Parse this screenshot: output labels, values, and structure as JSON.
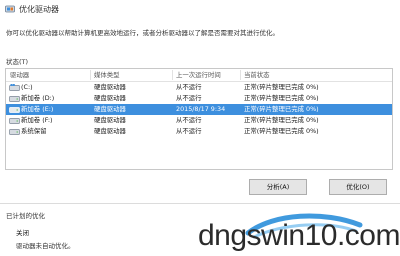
{
  "window": {
    "title": "优化驱动器"
  },
  "description": "你可以优化驱动器以帮助计算机更高效地运行，或者分析驱动器以了解是否需要对其进行优化。",
  "status_section": {
    "label": "状态(T)"
  },
  "drive_table": {
    "columns": [
      "驱动器",
      "媒体类型",
      "上一次运行时间",
      "当前状态"
    ],
    "rows": [
      {
        "drive": "(C:)",
        "media_type": "硬盘驱动器",
        "last_run": "从不运行",
        "status": "正常(碎片整理已完成 0%)",
        "selected": false,
        "icon": "hdd-windows-icon"
      },
      {
        "drive": "新加卷 (D:)",
        "media_type": "硬盘驱动器",
        "last_run": "从不运行",
        "status": "正常(碎片整理已完成 0%)",
        "selected": false,
        "icon": "hdd-icon"
      },
      {
        "drive": "新加卷 (E:)",
        "media_type": "硬盘驱动器",
        "last_run": "2015/8/17 9:34",
        "status": "正常(碎片整理已完成 0%)",
        "selected": true,
        "icon": "hdd-icon"
      },
      {
        "drive": "新加卷 (F:)",
        "media_type": "硬盘驱动器",
        "last_run": "从不运行",
        "status": "正常(碎片整理已完成 0%)",
        "selected": false,
        "icon": "hdd-icon"
      },
      {
        "drive": "系统保留",
        "media_type": "硬盘驱动器",
        "last_run": "从不运行",
        "status": "正常(碎片整理已完成 0%)",
        "selected": false,
        "icon": "hdd-icon"
      }
    ]
  },
  "buttons": {
    "analyze": "分析(A)",
    "optimize": "优化(O)"
  },
  "scheduled": {
    "label": "已计划的优化",
    "state": "关闭",
    "description": "驱动器未自动优化。"
  },
  "watermark": {
    "text": "dngswin10.com"
  },
  "colors": {
    "selection": "#3d8fde",
    "button_face": "#e5e5e5",
    "watermark_blue": "#1e88d8"
  }
}
